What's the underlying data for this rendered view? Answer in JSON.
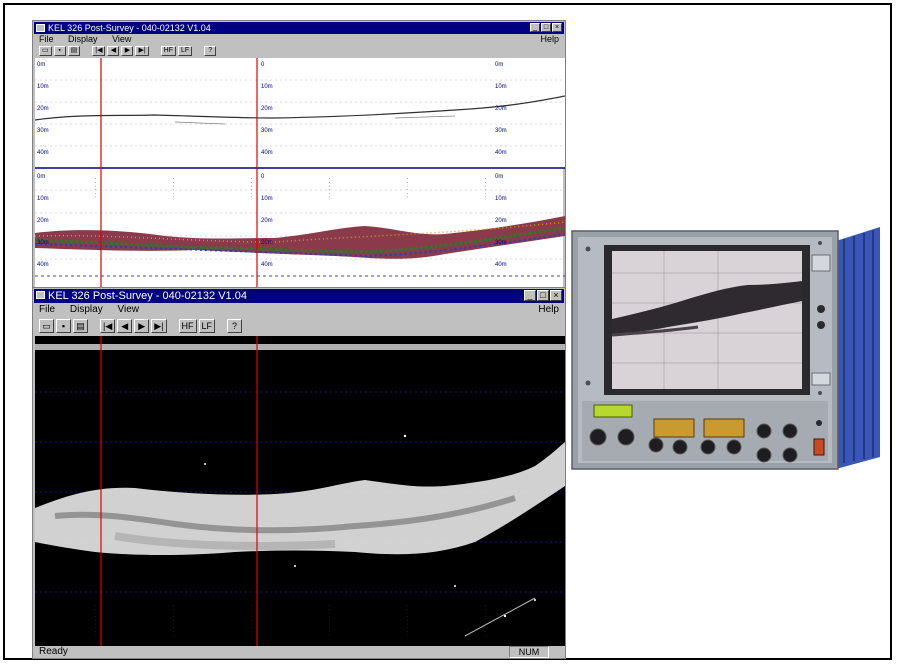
{
  "top_window": {
    "title": "KEL 326 Post-Survey - 040-02132 V1.04",
    "menu": [
      "File",
      "Display",
      "View"
    ],
    "help": "Help",
    "toolbar": {
      "first": "|◀",
      "prev": "◀",
      "next": "▶",
      "last": "▶|",
      "hf": "HF",
      "lf": "LF",
      "help": "?"
    },
    "status": "Ready",
    "status_num": "NUM",
    "depth_labels_left": [
      "0m",
      "10m",
      "20m",
      "30m",
      "40m"
    ],
    "depth_labels_mid": [
      "0",
      "10m",
      "20m",
      "30m",
      "40m"
    ],
    "depth_labels_right": [
      "0m",
      "10m",
      "20m",
      "30m",
      "40m"
    ]
  },
  "bottom_window": {
    "title": "KEL 326 Post-Survey - 040-02132 V1.04",
    "menu": [
      "File",
      "Display",
      "View"
    ],
    "help": "Help",
    "toolbar": {
      "first": "|◀",
      "prev": "◀",
      "next": "▶",
      "last": "▶|",
      "hf": "HF",
      "lf": "LF",
      "help": "?"
    },
    "status": "Ready",
    "status_num": "NUM"
  },
  "colors": {
    "title_bar": "#000080",
    "window_face": "#c0c0c0",
    "marker_line": "#e00000",
    "depth_grid": "#0000c0"
  }
}
